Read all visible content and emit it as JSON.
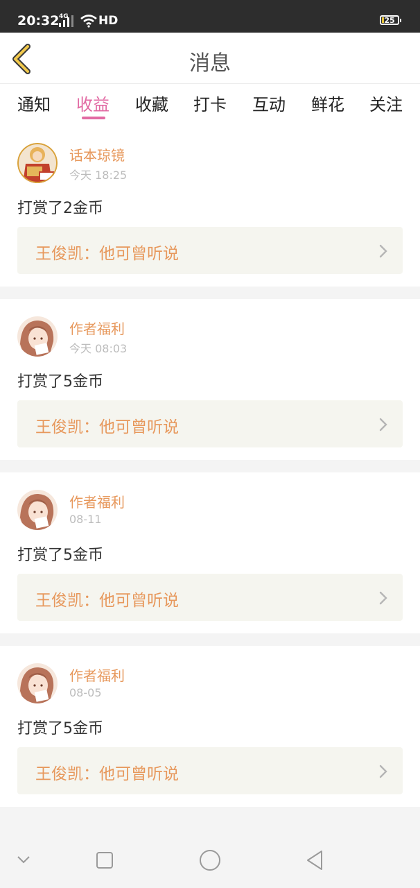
{
  "status_bar": {
    "time": "20:32",
    "network": "4G",
    "hd": "HD",
    "battery": "25"
  },
  "header": {
    "title": "消息"
  },
  "tabs": [
    {
      "label": "通知"
    },
    {
      "label": "收益"
    },
    {
      "label": "收藏"
    },
    {
      "label": "打卡"
    },
    {
      "label": "互动"
    },
    {
      "label": "鲜花"
    },
    {
      "label": "关注"
    }
  ],
  "active_tab": "收益",
  "messages": [
    {
      "sender": "话本琼镜",
      "time": "今天 18:25",
      "text": "打赏了2金币",
      "reference": "王俊凯：他可曾听说",
      "avatar": "book-cover-avatar"
    },
    {
      "sender": "作者福利",
      "time": "今天 08:03",
      "text": "打赏了5金币",
      "reference": "王俊凯：他可曾听说",
      "avatar": "anime-girl-avatar"
    },
    {
      "sender": "作者福利",
      "time": "08-11",
      "text": "打赏了5金币",
      "reference": "王俊凯：他可曾听说",
      "avatar": "anime-girl-avatar"
    },
    {
      "sender": "作者福利",
      "time": "08-05",
      "text": "打赏了5金币",
      "reference": "王俊凯：他可曾听说",
      "avatar": "anime-girl-avatar"
    }
  ],
  "colors": {
    "accent_pink": "#e26aa3",
    "sender_orange": "#e7985c",
    "back_arrow": "#f2c94c",
    "status_bar": "#2d2d2d"
  }
}
